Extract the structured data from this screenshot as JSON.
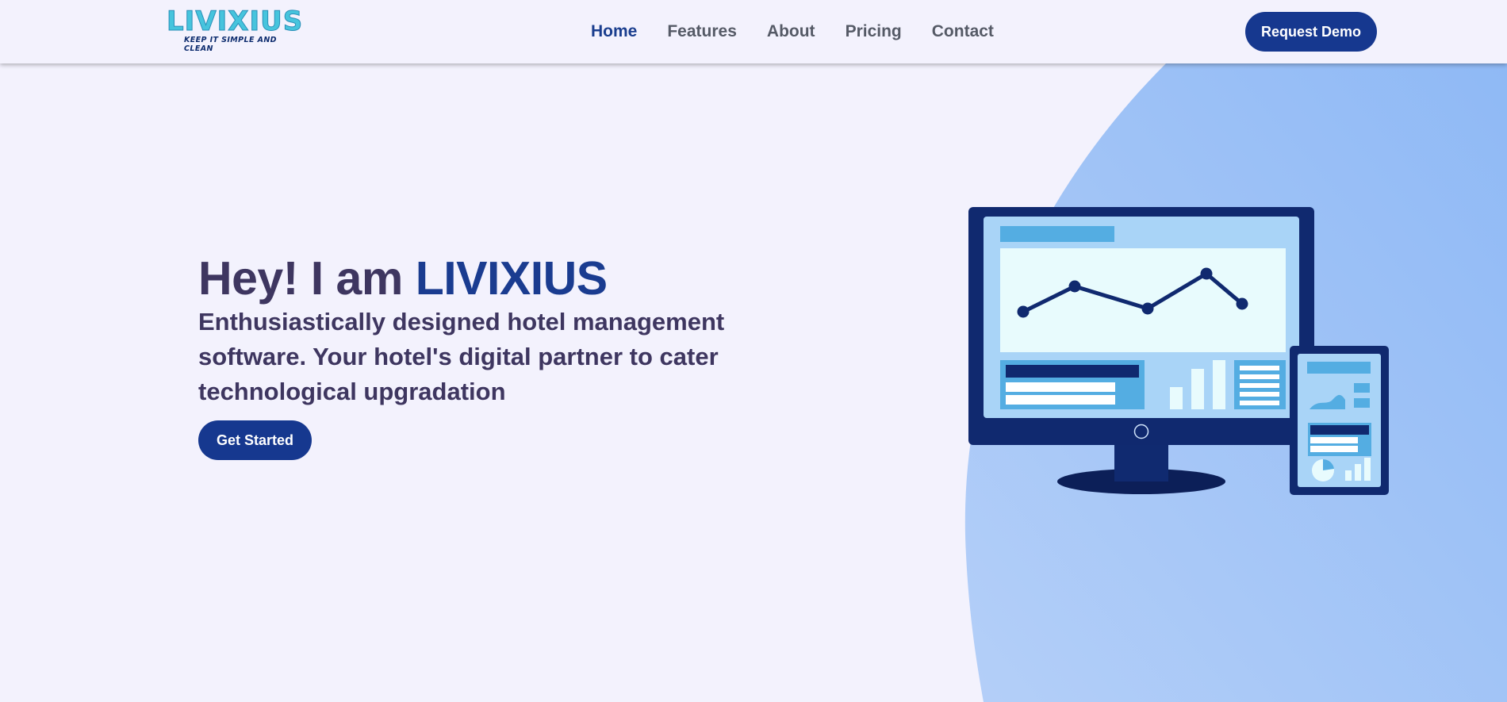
{
  "brand": {
    "logo_text": "LIVIXIUS",
    "tagline": "KEEP IT SIMPLE AND CLEAN"
  },
  "nav": {
    "items": [
      {
        "label": "Home",
        "active": true
      },
      {
        "label": "Features",
        "active": false
      },
      {
        "label": "About",
        "active": false
      },
      {
        "label": "Pricing",
        "active": false
      },
      {
        "label": "Contact",
        "active": false
      }
    ],
    "cta_label": "Request Demo"
  },
  "hero": {
    "title_prefix": "Hey! I am",
    "title_brand": "LIVIXIUS",
    "subtitle": "Enthusiastically designed hotel management software. Your hotel's digital partner to cater technological upgradation",
    "cta_label": "Get Started"
  },
  "illustration": {
    "kind": "dashboard-devices-illustration"
  },
  "colors": {
    "page_bg": "#f3f2fd",
    "accent": "#16388f",
    "nav_active": "#1a3e8e",
    "text_dark": "#3e3660",
    "nav_text": "#555a66",
    "blob": "#a7c6f7",
    "logo": "#46c4dd"
  }
}
